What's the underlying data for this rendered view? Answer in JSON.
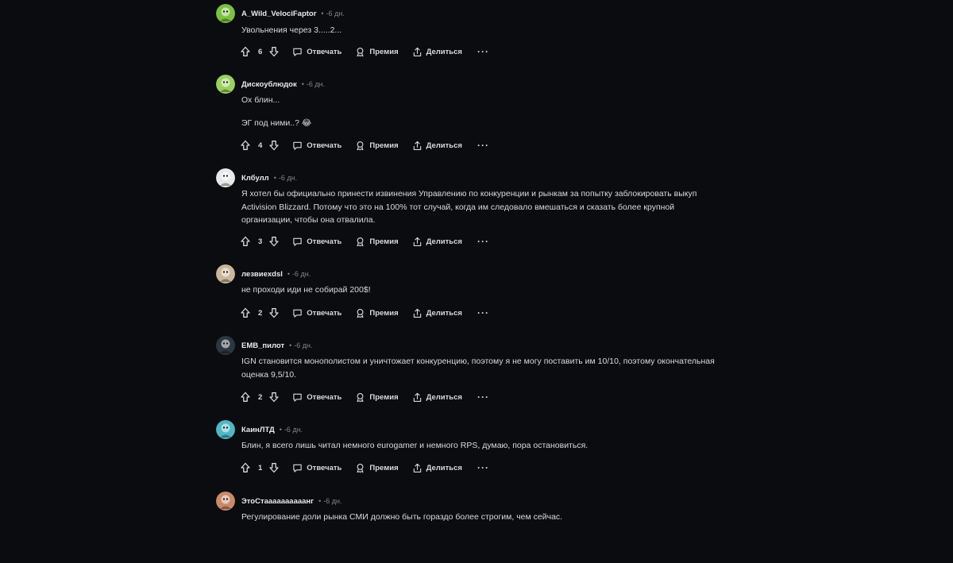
{
  "comments": [
    {
      "username": "A_Wild_VelociFaptor",
      "sep": "•",
      "time": "-6 дн.",
      "body": [
        "Увольнения через 3.....2..."
      ],
      "score": "6",
      "avatar_color": "#7bc043"
    },
    {
      "username": "Дискоублюдок",
      "sep": "•",
      "time": "-6 дн.",
      "body": [
        "Ох блин...",
        "ЭГ под ними..? 😂"
      ],
      "score": "4",
      "avatar_color": "#9ccf62"
    },
    {
      "username": "Клбулл",
      "sep": "•",
      "time": "-6 дн.",
      "body": [
        "Я хотел бы официально принести извинения Управлению по конкуренции и рынкам за попытку заблокировать выкуп Activision Blizzard. Потому что это на 100% тот случай, когда им следовало вмешаться и сказать более крупной организации, чтобы она отвалила."
      ],
      "score": "3",
      "avatar_color": "#e8e8e8"
    },
    {
      "username": "лезвиexdsl",
      "sep": "•",
      "time": "-6 дн.",
      "body": [
        "не проходи иди не собирай 200$!"
      ],
      "score": "2",
      "avatar_color": "#c9b79c"
    },
    {
      "username": "EMB_пилот",
      "sep": "•",
      "time": "-6 дн.",
      "body": [
        "IGN становится монополистом и уничтожает конкуренцию, поэтому я не могу поставить им 10/10, поэтому окончательная оценка 9,5/10."
      ],
      "score": "2",
      "avatar_color": "#2c3640"
    },
    {
      "username": "КаинЛТД",
      "sep": "•",
      "time": "-6 дн.",
      "body": [
        "Блин, я всего лишь читал немного eurogamer и немного RPS, думаю, пора остановиться."
      ],
      "score": "1",
      "avatar_color": "#4fb7c6"
    },
    {
      "username": "ЭтоСтаааааааааанг",
      "sep": "•",
      "time": "-6 дн.",
      "body": [
        "Регулирование доли рынка СМИ должно быть гораздо более строгим, чем сейчас."
      ],
      "score": "",
      "avatar_color": "#c98a6a"
    }
  ],
  "actions": {
    "reply": "Отвечать",
    "award": "Премия",
    "share": "Делиться",
    "more": "···"
  },
  "colors": {
    "background": "#0b0c0f",
    "text": "#d7dadc",
    "meta": "#818384"
  },
  "icons": {
    "upvote": "arrow-up-icon",
    "downvote": "arrow-down-icon",
    "reply": "speech-bubble-icon",
    "award": "award-ribbon-icon",
    "share": "share-upload-icon",
    "more": "ellipsis-icon"
  }
}
